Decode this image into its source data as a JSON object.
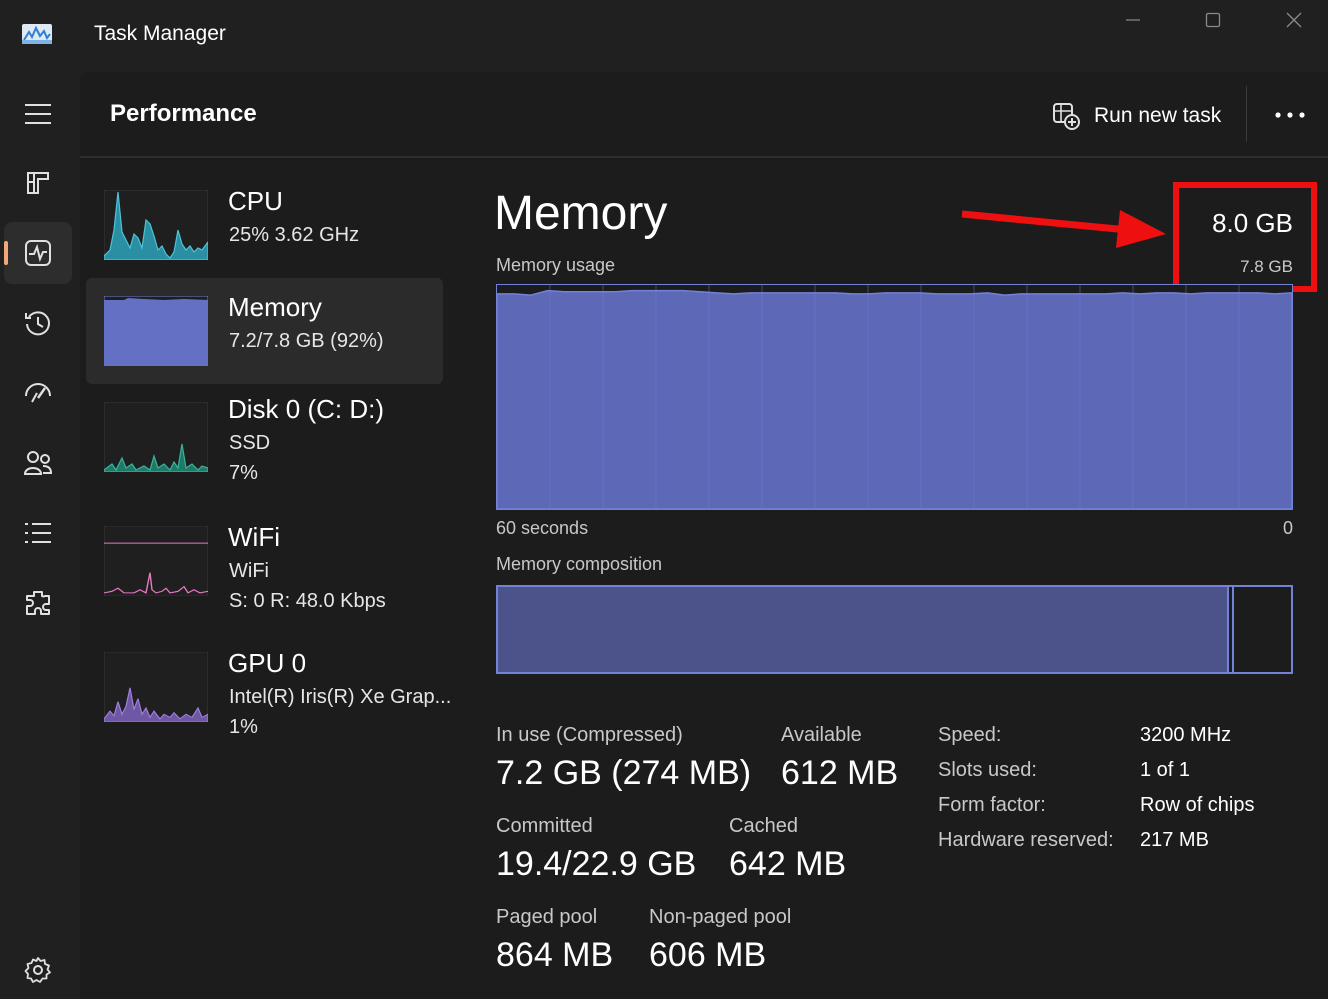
{
  "app": {
    "title": "Task Manager"
  },
  "window_controls": {
    "minimize": "minimize-icon",
    "maximize": "maximize-icon",
    "close": "close-icon"
  },
  "nav": {
    "items": [
      {
        "icon": "hamburger-menu-icon"
      },
      {
        "icon": "processes-icon"
      },
      {
        "icon": "performance-icon",
        "active": true
      },
      {
        "icon": "app-history-icon"
      },
      {
        "icon": "startup-apps-icon"
      },
      {
        "icon": "users-icon"
      },
      {
        "icon": "details-icon"
      },
      {
        "icon": "services-icon"
      },
      {
        "icon": "settings-icon"
      }
    ]
  },
  "header": {
    "title": "Performance",
    "run_new_task": "Run new task",
    "more_icon": "more-options-icon"
  },
  "devices": [
    {
      "name": "CPU",
      "line1": "25%  3.62 GHz",
      "line2": "",
      "color": "#4fc3d8"
    },
    {
      "name": "Memory",
      "line1": "7.2/7.8 GB (92%)",
      "line2": "",
      "color": "#7381d6",
      "active": true
    },
    {
      "name": "Disk 0 (C: D:)",
      "line1": "SSD",
      "line2": "7%",
      "color": "#3bb39b"
    },
    {
      "name": "WiFi",
      "line1": "WiFi",
      "line2": "S:  0  R:  48.0 Kbps",
      "color": "#e879c2"
    },
    {
      "name": "GPU 0",
      "line1": "Intel(R) Iris(R) Xe Grap...",
      "line2": "1%",
      "color": "#a17ee0"
    }
  ],
  "detail": {
    "title": "Memory",
    "total": "8.0 GB",
    "usage_label": "Memory usage",
    "usage_max": "7.8 GB",
    "axis_left": "60 seconds",
    "axis_right": "0",
    "composition_label": "Memory composition",
    "composition": {
      "in_use_fraction": 0.922,
      "modified_fraction": 0.006
    },
    "usage_history_pct": [
      96,
      96,
      95.5,
      97.5,
      97,
      97,
      97,
      97,
      97.5,
      97.5,
      97.5,
      97.5,
      97,
      96.5,
      96,
      96.5,
      96.5,
      96.5,
      96.5,
      96.5,
      96.5,
      96,
      96,
      96.5,
      96.5,
      96.5,
      96,
      96,
      96,
      96.5,
      95.5,
      96,
      96,
      96,
      96,
      96,
      96,
      96.5,
      96,
      96.5,
      96.5,
      96,
      96.5,
      96.5,
      96.5,
      96.5,
      96,
      96.5
    ],
    "accent_color": "#7381d6",
    "annotation_color": "#ee1010"
  },
  "stats": {
    "in_use_label": "In use (Compressed)",
    "in_use_value": "7.2 GB (274 MB)",
    "available_label": "Available",
    "available_value": "612 MB",
    "committed_label": "Committed",
    "committed_value": "19.4/22.9 GB",
    "cached_label": "Cached",
    "cached_value": "642 MB",
    "paged_label": "Paged pool",
    "paged_value": "864 MB",
    "nonpaged_label": "Non-paged pool",
    "nonpaged_value": "606 MB"
  },
  "specs": {
    "speed_label": "Speed:",
    "speed_value": "3200 MHz",
    "slots_label": "Slots used:",
    "slots_value": "1 of 1",
    "form_label": "Form factor:",
    "form_value": "Row of chips",
    "reserved_label": "Hardware reserved:",
    "reserved_value": "217 MB"
  }
}
